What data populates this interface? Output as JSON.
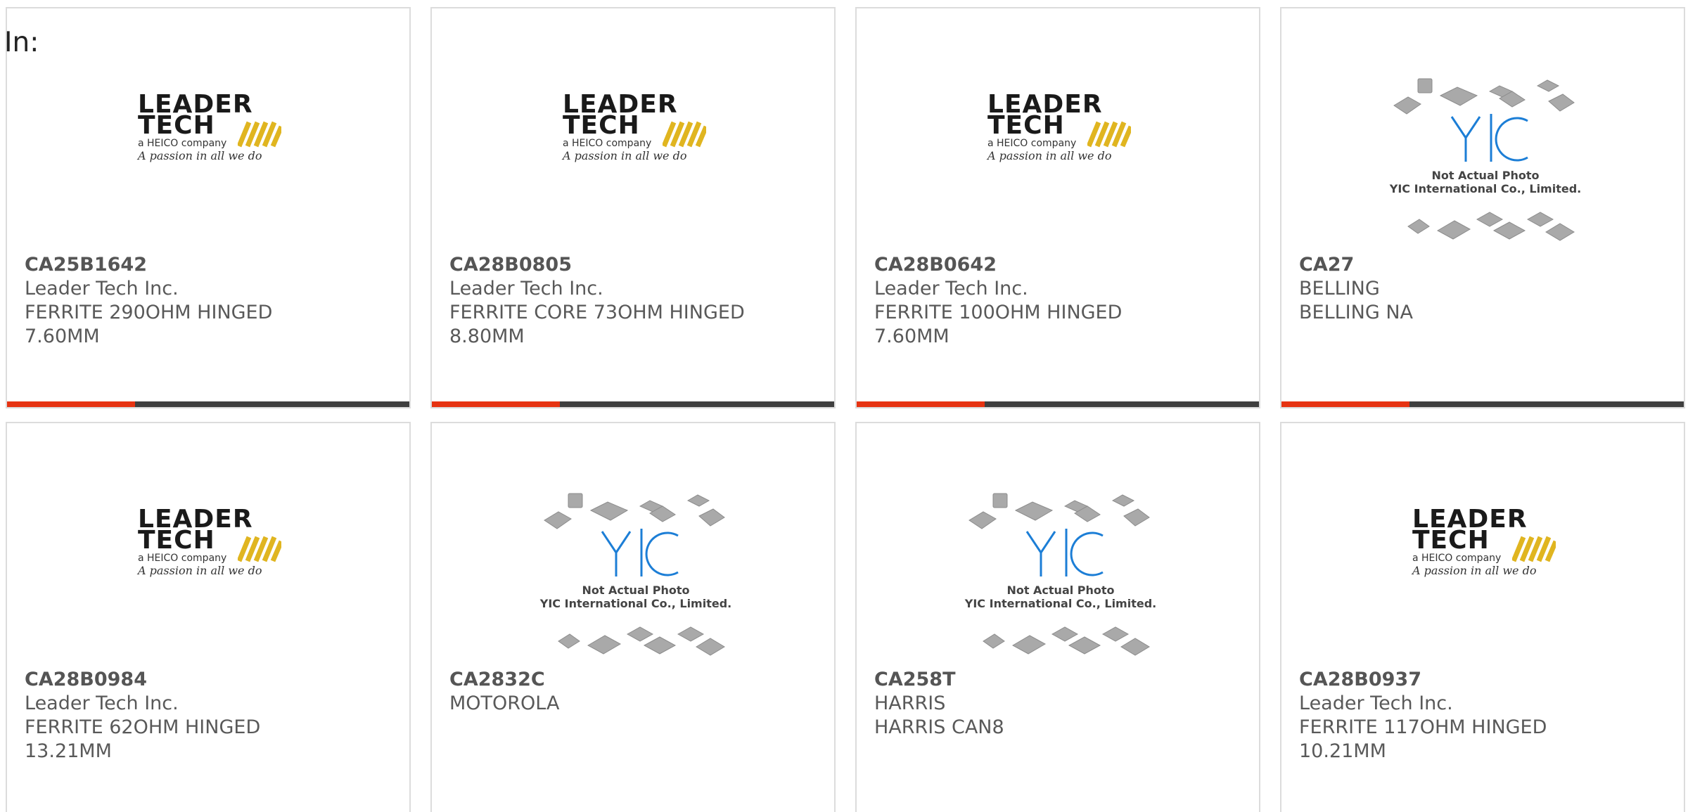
{
  "header": {
    "label": "In:"
  },
  "colors": {
    "accent": "#e63312",
    "bar": "#3f3f3f",
    "yic_blue": "#1c7ed6"
  },
  "logos": {
    "leadertech": {
      "word1": "LEADER",
      "word2": "TECH",
      "sub": "a HEICO company",
      "script": "A passion in all we do"
    },
    "yic": {
      "mark": "YIC",
      "line1": "Not Actual Photo",
      "line2": "YIC International Co., Limited."
    }
  },
  "products": [
    {
      "part": "CA25B1642",
      "maker": "Leader Tech Inc.",
      "desc1": "FERRITE 290OHM HINGED",
      "desc2": "7.60MM",
      "image": "leadertech-logo"
    },
    {
      "part": "CA28B0805",
      "maker": "Leader Tech Inc.",
      "desc1": "FERRITE CORE 73OHM HINGED",
      "desc2": "8.80MM",
      "image": "leadertech-logo"
    },
    {
      "part": "CA28B0642",
      "maker": "Leader Tech Inc.",
      "desc1": "FERRITE 100OHM HINGED",
      "desc2": "7.60MM",
      "image": "leadertech-logo"
    },
    {
      "part": "CA27",
      "maker": "BELLING",
      "desc1": "BELLING NA",
      "desc2": "",
      "image": "yic-placeholder"
    },
    {
      "part": "CA28B0984",
      "maker": "Leader Tech Inc.",
      "desc1": "FERRITE 62OHM HINGED",
      "desc2": "13.21MM",
      "image": "leadertech-logo"
    },
    {
      "part": "CA2832C",
      "maker": "MOTOROLA",
      "desc1": "",
      "desc2": "",
      "image": "yic-placeholder"
    },
    {
      "part": "CA258T",
      "maker": "HARRIS",
      "desc1": "HARRIS CAN8",
      "desc2": "",
      "image": "yic-placeholder"
    },
    {
      "part": "CA28B0937",
      "maker": "Leader Tech Inc.",
      "desc1": "FERRITE 117OHM HINGED",
      "desc2": "10.21MM",
      "image": "leadertech-logo"
    }
  ]
}
